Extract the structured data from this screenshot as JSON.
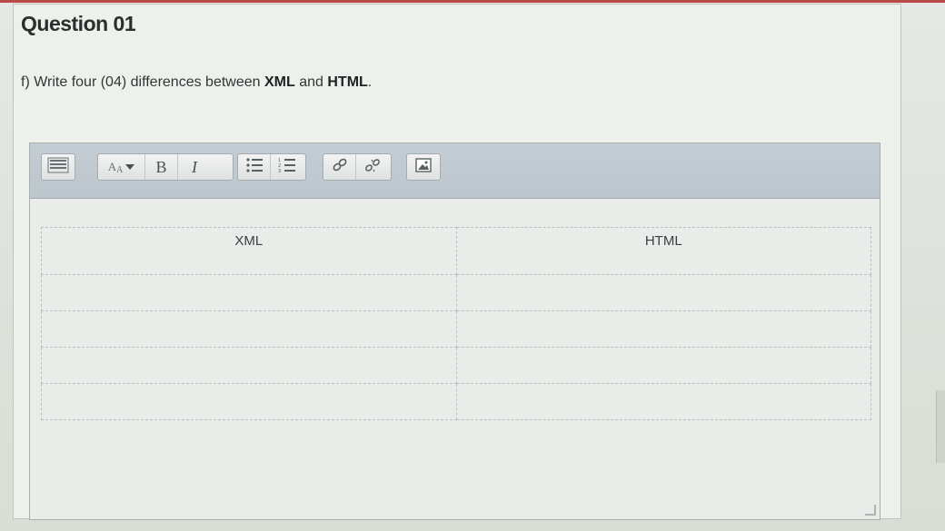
{
  "question": {
    "title": "Question 01",
    "text_prefix": "f) Write four (04) differences between ",
    "text_bold1": "XML",
    "text_mid": " and ",
    "text_bold2": "HTML",
    "text_suffix": "."
  },
  "toolbar": {
    "font_size_label": "A",
    "bold_label": "B",
    "italic_label": "I",
    "icons": [
      "toolbar-toggle-icon",
      "font-size-icon",
      "bold-icon",
      "italic-icon",
      "unordered-list-icon",
      "ordered-list-icon",
      "link-icon",
      "unlink-icon",
      "image-icon"
    ]
  },
  "table": {
    "headers": [
      "XML",
      "HTML"
    ],
    "rows": [
      [
        "",
        ""
      ],
      [
        "",
        ""
      ],
      [
        "",
        ""
      ],
      [
        "",
        ""
      ]
    ]
  },
  "colors": {
    "toolbar_bg": "#c3cdd3",
    "panel_bg": "#eef0ec",
    "accent_red": "#b94a4a"
  }
}
